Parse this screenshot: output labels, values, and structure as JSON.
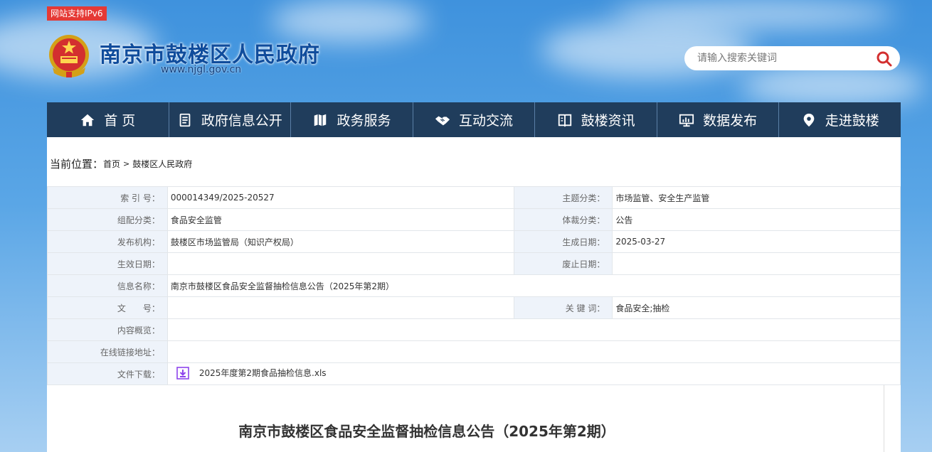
{
  "header": {
    "ipv6_badge": "网站支持IPv6",
    "site_title": "南京市鼓楼区人民政府",
    "site_url": "www.njgl.gov.cn",
    "search_placeholder": "请输入搜索关键词"
  },
  "nav": [
    {
      "label": "首 页",
      "icon": "home-icon"
    },
    {
      "label": "政府信息公开",
      "icon": "document-icon"
    },
    {
      "label": "政务服务",
      "icon": "map-icon"
    },
    {
      "label": "互动交流",
      "icon": "handshake-icon"
    },
    {
      "label": "鼓楼资讯",
      "icon": "book-icon"
    },
    {
      "label": "数据发布",
      "icon": "monitor-icon"
    },
    {
      "label": "走进鼓楼",
      "icon": "location-icon"
    }
  ],
  "breadcrumb": {
    "prefix": "当前位置：",
    "items": [
      "首页",
      "鼓楼区人民政府"
    ],
    "separator": ">"
  },
  "meta": {
    "index_no_label": "索 引 号：",
    "index_no": "000014349/2025-20527",
    "topic_label": "主题分类：",
    "topic": "市场监管、安全生产监管",
    "org_cat_label": "组配分类：",
    "org_cat": "食品安全监管",
    "genre_label": "体裁分类：",
    "genre": "公告",
    "publisher_label": "发布机构：",
    "publisher": "鼓楼区市场监管局（知识产权局）",
    "created_label": "生成日期：",
    "created": "2025-03-27",
    "effective_label": "生效日期：",
    "effective": "",
    "abolish_label": "废止日期：",
    "abolish": "",
    "info_name_label": "信息名称：",
    "info_name": "南京市鼓楼区食品安全监督抽检信息公告（2025年第2期）",
    "doc_no_label": "文　　号：",
    "doc_no": "",
    "keywords_label": "关 键 词：",
    "keywords": "食品安全;抽检",
    "summary_label": "内容概览：",
    "summary": "",
    "link_label": "在线链接地址：",
    "link": "",
    "download_label": "文件下载：",
    "download_file": "2025年度第2期食品抽检信息.xls"
  },
  "article": {
    "title": "南京市鼓楼区食品安全监督抽检信息公告（2025年第2期）"
  },
  "colors": {
    "nav_bg": "#203d5c",
    "title_blue": "#0f4c9c",
    "badge_red": "#e53935",
    "label_bg": "#eef3fa"
  }
}
